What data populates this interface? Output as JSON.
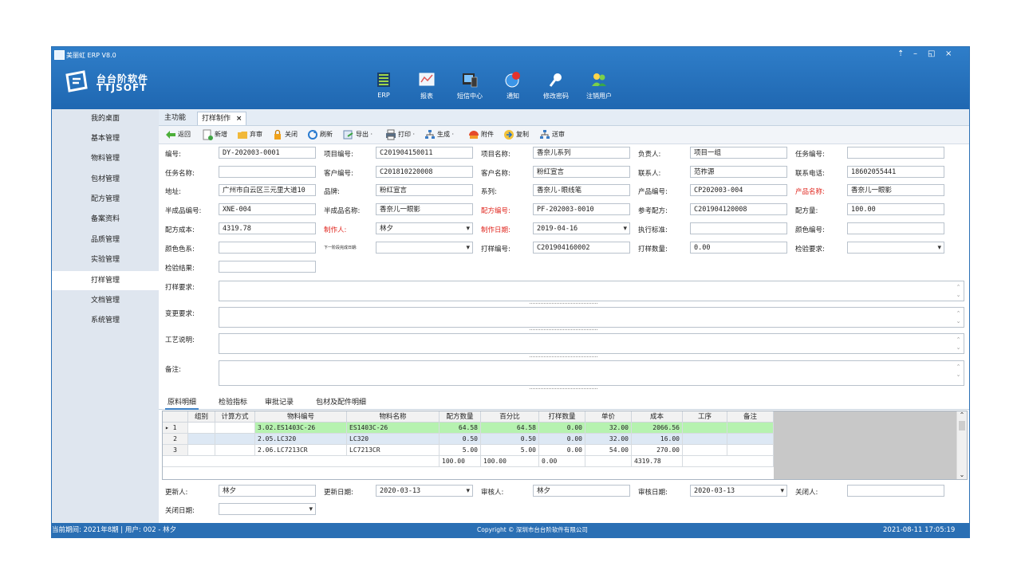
{
  "window": {
    "title": "美丽虹 ERP V8.0",
    "controls": [
      "⇡",
      "–",
      "◱",
      "×"
    ]
  },
  "brand": {
    "line1": "台台阶软件",
    "line2": "TTJSOFT"
  },
  "top_toolbar": [
    {
      "label": "ERP",
      "icon": "erp-icon"
    },
    {
      "label": "报表",
      "icon": "report-icon"
    },
    {
      "label": "短信中心",
      "icon": "sms-icon"
    },
    {
      "label": "通知",
      "icon": "notify-icon",
      "badge": "11"
    },
    {
      "label": "修改密码",
      "icon": "key-icon"
    },
    {
      "label": "注销用户",
      "icon": "users-icon"
    }
  ],
  "sidebar": {
    "items": [
      "我的桌面",
      "基本管理",
      "物料管理",
      "包材管理",
      "配方管理",
      "备案资料",
      "品质管理",
      "实验管理",
      "打样管理",
      "文档管理",
      "系统管理"
    ],
    "active": 8
  },
  "tabs": {
    "home": "主功能",
    "current": "打样制作",
    "close": "×"
  },
  "toolbar": [
    "返回",
    "新增",
    "弃审",
    "关闭",
    "刷新",
    "导出 ·",
    "打印 ·",
    "生成 ·",
    "附件",
    "复制",
    "送审"
  ],
  "form": {
    "r1": {
      "l1": "编号:",
      "v1": "DY-202003-0001",
      "l2": "项目编号:",
      "v2": "C201904150011",
      "l3": "项目名称:",
      "v3": "香奈儿系列",
      "l4": "负责人:",
      "v4": "项目一组",
      "l5": "任务编号:",
      "v5": ""
    },
    "r2": {
      "l1": "任务名称:",
      "v1": "",
      "l2": "客户编号:",
      "v2": "C201810220008",
      "l3": "客户名称:",
      "v3": "粉红宣言",
      "l4": "联系人:",
      "v4": "范祚源",
      "l5": "联系电话:",
      "v5": "18602055441"
    },
    "r3": {
      "l1": "地址:",
      "v1": "广州市白云区三元里大道10",
      "l2": "品牌:",
      "v2": "粉红宣言",
      "l3": "系列:",
      "v3": "香奈儿-眼线笔",
      "l4": "产品编号:",
      "v4": "CP202003-004",
      "l5": "产品名称:",
      "v5": "香奈儿一眼影"
    },
    "r4": {
      "l1": "半成品编号:",
      "v1": "XNE-004",
      "l2": "半成品名称:",
      "v2": "香奈儿一眼影",
      "l3": "配方编号:",
      "v3": "PF-202003-0010",
      "l4": "参考配方:",
      "v4": "C201904120008",
      "l5": "配方量:",
      "v5": "100.00"
    },
    "r5": {
      "l1": "配方成本:",
      "v1": "4319.78",
      "l2": "制作人:",
      "v2": "林夕",
      "l3": "制作日期:",
      "v3": "2019-04-16",
      "l4": "执行标准:",
      "v4": "",
      "l5": "颜色编号:",
      "v5": ""
    },
    "r6": {
      "l1": "颜色色系:",
      "v1": "",
      "l2": "下一阶段完成日期:",
      "v2": "",
      "l3": "打样编号:",
      "v3": "C201904160002",
      "l4": "打样数量:",
      "v4": "0.00",
      "l5": "检验要求:",
      "v5": ""
    },
    "r7": {
      "l1": "检验结果:",
      "v1": ""
    },
    "big": [
      "打样要求:",
      "变更要求:",
      "工艺说明:",
      "备注:"
    ]
  },
  "detail_tabs": [
    "原料明细",
    "检验指标",
    "审批记录",
    "包材及配件明细"
  ],
  "grid": {
    "headers": [
      "组别",
      "计算方式",
      "物料编号",
      "物料名称",
      "配方数量",
      "百分比",
      "打样数量",
      "单价",
      "成本",
      "工序",
      "备注"
    ],
    "rows": [
      {
        "idx": "1",
        "marker": "▸",
        "group": "",
        "method": "",
        "code": "3.02.ES1403C-26",
        "name": "ES1403C-26",
        "qty": "64.58",
        "pct": "64.58",
        "sample": "0.00",
        "price": "32.00",
        "cost": "2066.56",
        "proc": "",
        "note": ""
      },
      {
        "idx": "2",
        "marker": "",
        "group": "",
        "method": "",
        "code": "2.05.LC320",
        "name": "LC320",
        "qty": "0.50",
        "pct": "0.50",
        "sample": "0.00",
        "price": "32.00",
        "cost": "16.00",
        "proc": "",
        "note": ""
      },
      {
        "idx": "3",
        "marker": "",
        "group": "",
        "method": "",
        "code": "2.06.LC7213CR",
        "name": "LC7213CR",
        "qty": "5.00",
        "pct": "5.00",
        "sample": "0.00",
        "price": "54.00",
        "cost": "270.00",
        "proc": "",
        "note": ""
      }
    ],
    "totals": {
      "qty": "100.00",
      "pct": "100.00",
      "sample": "0.00",
      "cost": "4319.78"
    }
  },
  "footer_form": {
    "l1": "更新人:",
    "v1": "林夕",
    "l2": "更新日期:",
    "v2": "2020-03-13",
    "l3": "审核人:",
    "v3": "林夕",
    "l4": "审核日期:",
    "v4": "2020-03-13",
    "l5": "关闭人:",
    "v5": "",
    "l6": "关闭日期:",
    "v6": ""
  },
  "status": {
    "period": "当前期间:  2021年8期  |  用户:  002 - 林夕",
    "copyright": "Copyright © 深圳市台台阶软件有限公司",
    "datetime": "2021-08-11 17:05:19"
  },
  "colors": {
    "accent": "#2a6fb4",
    "selected_row": "#b6f2b0",
    "required_label": "#e0261e"
  }
}
